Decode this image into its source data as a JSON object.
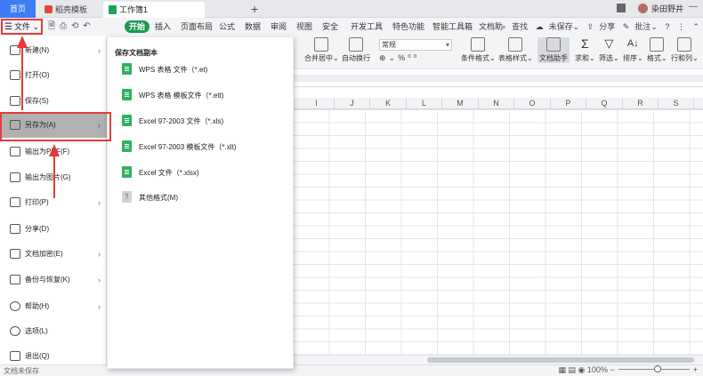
{
  "tabs": {
    "home": "首页",
    "template": "稻壳模板",
    "document": "工作簿1",
    "add": "+"
  },
  "user": {
    "name": "染田野井"
  },
  "menubar": {
    "file": "文件",
    "start": "开始",
    "items": [
      "插入",
      "页面布局",
      "公式",
      "数据",
      "审阅",
      "视图",
      "安全",
      "开发工具",
      "特色功能",
      "智能工具箱",
      "文档助"
    ],
    "search": "查找",
    "unsaved": "未保存",
    "share": "分享",
    "comment": "批注"
  },
  "ribbon": {
    "merge": "合并居中",
    "wrap": "自动换行",
    "number_format": "常规",
    "cond_format": "条件格式",
    "table_style": "表格样式",
    "doc_assistant": "文档助手",
    "sum": "求和",
    "filter": "筛选",
    "sort": "排序",
    "format": "格式",
    "rowcol": "行和列"
  },
  "columns": [
    "I",
    "J",
    "K",
    "L",
    "M",
    "N",
    "O",
    "P",
    "Q",
    "R",
    "S"
  ],
  "file_menu": {
    "items": [
      {
        "label": "新建(N)",
        "arrow": true
      },
      {
        "label": "打开(O)",
        "arrow": false
      },
      {
        "label": "保存(S)",
        "arrow": false
      },
      {
        "label": "另存为(A)",
        "arrow": true
      },
      {
        "label": "输出为PDF(F)",
        "arrow": false
      },
      {
        "label": "输出为图片(G)",
        "arrow": false
      },
      {
        "label": "打印(P)",
        "arrow": true
      },
      {
        "label": "分享(D)",
        "arrow": false
      },
      {
        "label": "文档加密(E)",
        "arrow": true
      },
      {
        "label": "备份与恢复(K)",
        "arrow": true
      },
      {
        "label": "帮助(H)",
        "arrow": true
      },
      {
        "label": "选项(L)",
        "arrow": false
      },
      {
        "label": "退出(Q)",
        "arrow": false
      }
    ]
  },
  "submenu": {
    "title": "保存文档副本",
    "items": [
      "WPS 表格 文件（*.et)",
      "WPS 表格 模板文件（*.ett)",
      "Excel 97-2003 文件（*.xls)",
      "Excel 97-2003 模板文件（*.xlt)",
      "Excel 文件（*.xlsx)",
      "其他格式(M)"
    ]
  },
  "statusbar": {
    "left": "文档未保存",
    "zoom": "100%"
  }
}
